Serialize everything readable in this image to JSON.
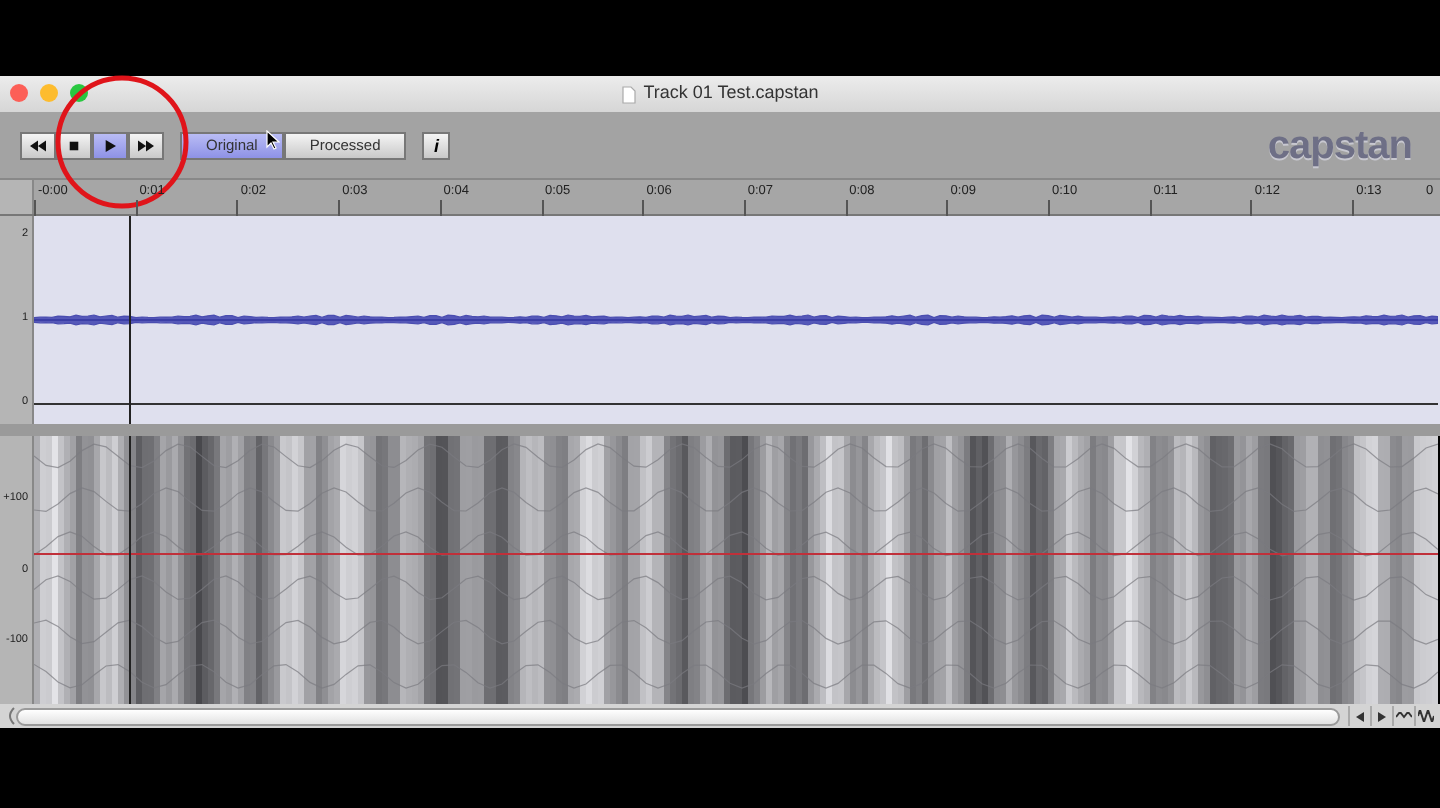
{
  "window": {
    "title": "Track 01 Test.capstan"
  },
  "transport": [
    {
      "kind": "rewind",
      "selected": false
    },
    {
      "kind": "stop",
      "selected": false
    },
    {
      "kind": "play",
      "selected": true
    },
    {
      "kind": "forward",
      "selected": false
    }
  ],
  "view_toggle": [
    {
      "label": "Original",
      "selected": true
    },
    {
      "label": "Processed",
      "selected": false
    }
  ],
  "info_button": {
    "label": "i"
  },
  "logo": "capstan",
  "ruler": [
    "-0:00",
    "0:01",
    "0:02",
    "0:03",
    "0:04",
    "0:05",
    "0:06",
    "0:07",
    "0:08",
    "0:09",
    "0:10",
    "0:11",
    "0:12",
    "0:13",
    "0"
  ],
  "waveform": {
    "axis": [
      "2",
      "1",
      "0"
    ]
  },
  "spectrogram": {
    "axis": [
      "+100",
      "0",
      "-100"
    ]
  }
}
